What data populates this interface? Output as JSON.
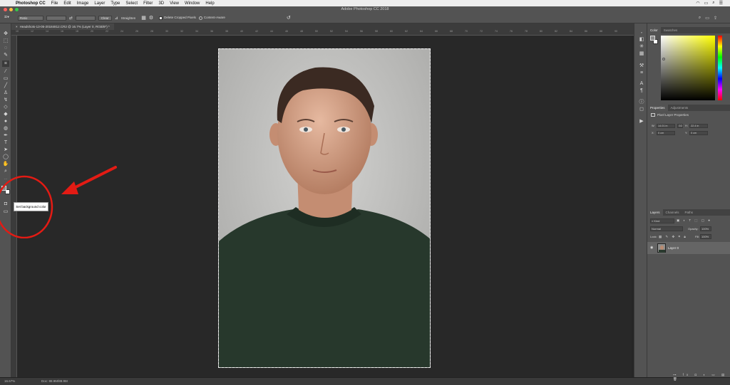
{
  "menubar": {
    "app_name": "Photoshop CC",
    "items": [
      "File",
      "Edit",
      "Image",
      "Layer",
      "Type",
      "Select",
      "Filter",
      "3D",
      "View",
      "Window",
      "Help"
    ]
  },
  "window_title": "Adobe Photoshop CC 2018",
  "options_bar": {
    "ratio_label": "Ratio",
    "clear_label": "Clear",
    "straighten_label": "Straighten",
    "delete_cropped_label": "Delete Cropped Pixels",
    "delete_cropped_checked": true,
    "content_aware_label": "Content-Aware"
  },
  "document_tab": "Headshots-13-05-20184812.CR2 @ 16.7% (Layer 0, RGB/8*) *",
  "ruler_ticks": [
    "10",
    "12",
    "14",
    "16",
    "18",
    "20",
    "22",
    "24",
    "26",
    "28",
    "30",
    "32",
    "34",
    "36",
    "38",
    "40",
    "42",
    "44",
    "46",
    "48",
    "50",
    "52",
    "54",
    "56",
    "58",
    "60",
    "62",
    "64",
    "66",
    "68",
    "70",
    "72",
    "74",
    "76",
    "78",
    "80",
    "82",
    "84",
    "86",
    "88",
    "90"
  ],
  "status": {
    "zoom": "16.67%",
    "doc": "Doc: 88.9M/88.9M"
  },
  "tooltip": "Set background color",
  "panels": {
    "color_tabs": [
      "Color",
      "Swatches"
    ],
    "properties_tabs": [
      "Properties",
      "Adjustments"
    ],
    "properties_title": "Pixel Layer Properties",
    "w_label": "W:",
    "w_value": "14.01 in",
    "go_label": "GO",
    "h_label": "H:",
    "h_value": "22.4 in",
    "x_label": "X:",
    "x_value": "0 cm",
    "y_label": "Y:",
    "y_value": "0 cm",
    "layers_tabs": [
      "Layers",
      "Channels",
      "Paths"
    ],
    "kind_label": "Kind",
    "blend_mode": "Normal",
    "opacity_label": "Opacity:",
    "opacity_value": "100%",
    "lock_label": "Lock:",
    "fill_label": "Fill:",
    "fill_value": "100%",
    "layer_name": "Layer 0"
  },
  "colors": {
    "accent_red": "#e31b14",
    "chrome": "#535353",
    "canvas_bg": "#282828"
  }
}
